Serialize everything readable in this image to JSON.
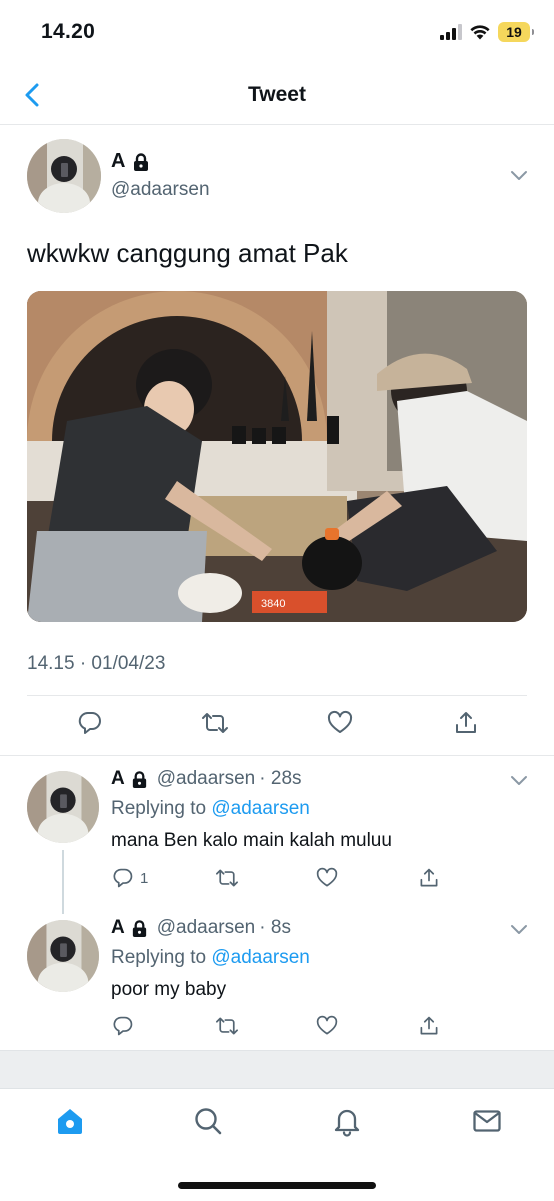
{
  "status_bar": {
    "time": "14.20",
    "battery": "19"
  },
  "nav": {
    "title": "Tweet"
  },
  "tweet": {
    "author_name": "A",
    "handle": "@adaarsen",
    "text": "wkwkw canggung amat Pak",
    "media_caption": "3840",
    "timestamp": "14.15 · 01/04/23"
  },
  "replies": [
    {
      "author_name": "A",
      "handle": "@adaarsen",
      "time_ago": "· 28s",
      "replying_prefix": "Replying to",
      "replying_to": "@adaarsen",
      "text": "mana Ben kalo main kalah muluu",
      "reply_count": "1"
    },
    {
      "author_name": "A",
      "handle": "@adaarsen",
      "time_ago": "· 8s",
      "replying_prefix": "Replying to",
      "replying_to": "@adaarsen",
      "text": "poor my baby",
      "reply_count": ""
    }
  ],
  "tabs": [
    "home",
    "search",
    "notifications",
    "messages"
  ],
  "icons": {
    "back": "chevron-left-icon",
    "lock": "lock-icon",
    "more": "chevron-down-icon",
    "reply": "reply-icon",
    "retweet": "retweet-icon",
    "like": "heart-icon",
    "share": "share-icon"
  },
  "colors": {
    "accent": "#1d9bf0",
    "text": "#0f1419",
    "secondary": "#536471",
    "battery": "#f5d75c"
  }
}
